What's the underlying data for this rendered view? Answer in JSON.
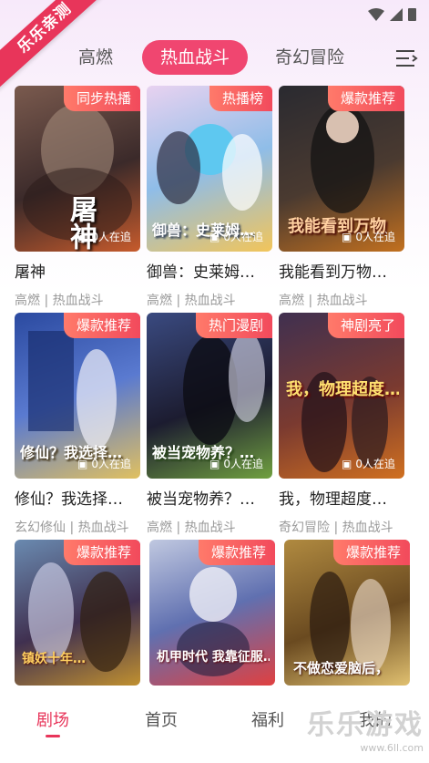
{
  "ribbon_text": "乐乐亲测",
  "tabs": [
    {
      "label": "高燃",
      "active": false
    },
    {
      "label": "热血战斗",
      "active": true
    },
    {
      "label": "奇幻冒险",
      "active": false
    }
  ],
  "accent_color": "#f04670",
  "cards": [
    {
      "badge": "同步热播",
      "followers": "0人在追",
      "title": "屠神",
      "tags": "高燃 | 热血战斗"
    },
    {
      "badge": "热播榜",
      "followers": "0人在追",
      "title": "御兽：史莱姆…",
      "tags": "高燃 | 热血战斗"
    },
    {
      "badge": "爆款推荐",
      "followers": "0人在追",
      "title": "我能看到万物…",
      "tags": "高燃 | 热血战斗"
    },
    {
      "badge": "爆款推荐",
      "followers": "0人在追",
      "title": "修仙？我选择…",
      "tags": "玄幻修仙 | 热血战斗"
    },
    {
      "badge": "热门漫剧",
      "followers": "0人在追",
      "title": "被当宠物养？…",
      "tags": "高燃 | 热血战斗"
    },
    {
      "badge": "神剧亮了",
      "followers": "0人在追",
      "title": "我，物理超度…",
      "tags": "奇幻冒险 | 热血战斗"
    },
    {
      "badge": "爆款推荐",
      "followers": "",
      "title": "",
      "tags": ""
    },
    {
      "badge": "爆款推荐",
      "followers": "",
      "title": "",
      "tags": ""
    },
    {
      "badge": "爆款推荐",
      "followers": "",
      "title": "",
      "tags": ""
    }
  ],
  "cover_text": [
    "屠神",
    "御兽：史莱姆…",
    "我能看到万物",
    "修仙？我选择…",
    "被当宠物养？…",
    "我，物理超度…",
    "镇妖十年…",
    "机甲时代 我靠征服…",
    "不做恋爱脑后，"
  ],
  "bottom_nav": [
    {
      "label": "剧场",
      "active": true
    },
    {
      "label": "首页",
      "active": false
    },
    {
      "label": "福利",
      "active": false
    },
    {
      "label": "我的",
      "active": false
    }
  ],
  "watermark": {
    "big": "乐乐游戏",
    "small": "www.6ll.com"
  }
}
